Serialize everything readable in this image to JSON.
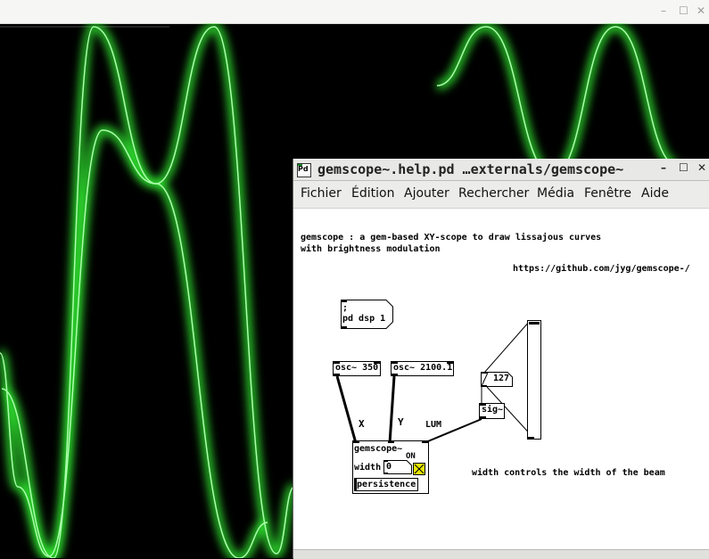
{
  "gem_window": {
    "controls": {
      "minimize": "–",
      "maximize": "☐",
      "close": "✕"
    },
    "scope_color": "#33ff33"
  },
  "pd_window": {
    "title": "gemscope~.help.pd  …externals/gemscope~",
    "app_icon": "Pd",
    "controls": {
      "minimize": "–",
      "maximize": "☐",
      "close": "✕"
    },
    "menu": [
      "Fichier",
      "Édition",
      "Ajouter",
      "Rechercher",
      "Média",
      "Fenêtre",
      "Aide"
    ],
    "canvas": {
      "description_line1": "gemscope : a gem-based XY-scope to draw lissajous curves",
      "description_line2": "with brightness modulation",
      "url": "https://github.com/jyg/gemscope-/",
      "msg_line1": ";",
      "msg_line2": "pd dsp 1",
      "osc1": "osc~ 350",
      "osc2": "osc~ 2100.1",
      "number_value": "127",
      "sig": "sig~",
      "label_x": "X",
      "label_y": "Y",
      "label_lum": "LUM",
      "gemscope_title": "gemscope~",
      "width_label": "width",
      "width_value": "0",
      "on_label": "ON",
      "persistence_label": "persistence",
      "width_comment": "width controls the width of the beam",
      "slider_value": 1.0
    }
  }
}
